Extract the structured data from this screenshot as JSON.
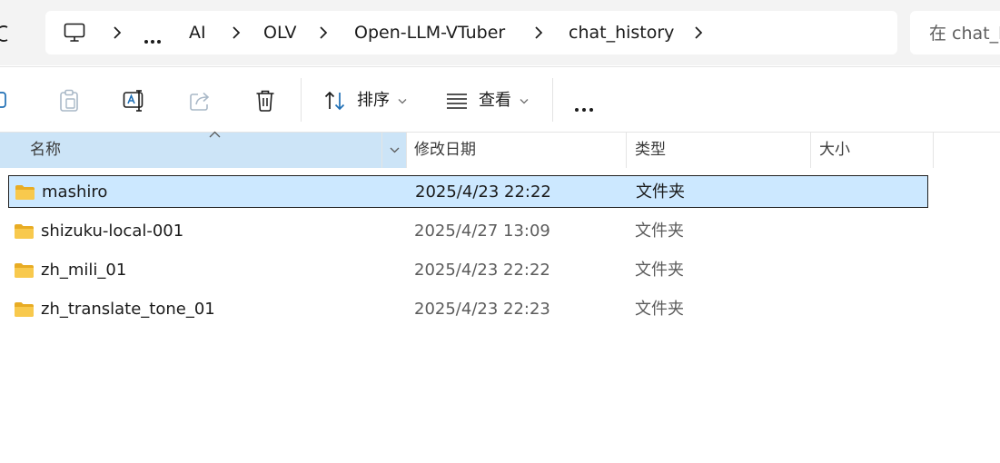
{
  "breadcrumb": {
    "items": [
      "AI",
      "OLV",
      "Open-LLM-VTuber",
      "chat_history"
    ]
  },
  "search": {
    "placeholder": "在 chat_h"
  },
  "commandbar": {
    "sort_label": "排序",
    "view_label": "查看"
  },
  "columns": {
    "name": "名称",
    "date": "修改日期",
    "type": "类型",
    "size": "大小"
  },
  "files": [
    {
      "name": "mashiro",
      "date": "2025/4/23 22:22",
      "type": "文件夹",
      "selected": true
    },
    {
      "name": "shizuku-local-001",
      "date": "2025/4/27 13:09",
      "type": "文件夹",
      "selected": false
    },
    {
      "name": "zh_mili_01",
      "date": "2025/4/23 22:22",
      "type": "文件夹",
      "selected": false
    },
    {
      "name": "zh_translate_tone_01",
      "date": "2025/4/23 22:23",
      "type": "文件夹",
      "selected": false
    }
  ],
  "colors": {
    "selection": "#cce8ff",
    "header_active": "#cce4f7",
    "folder": "#f8c94d"
  }
}
